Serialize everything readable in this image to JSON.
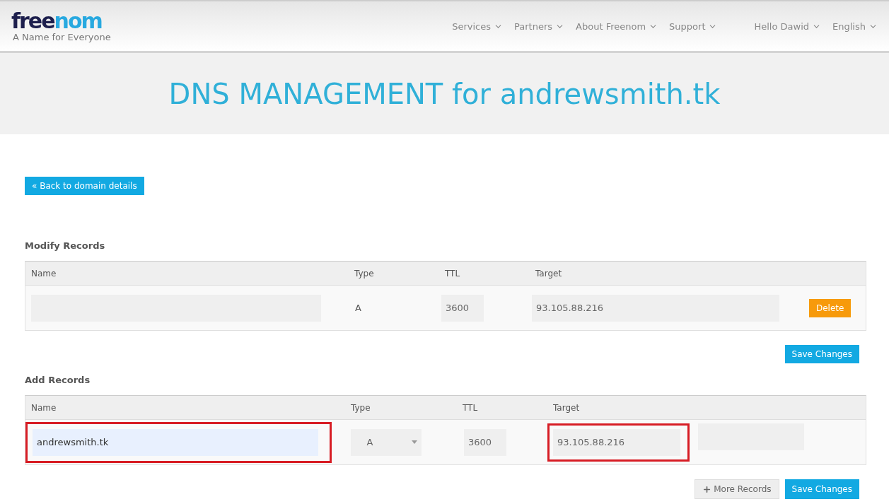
{
  "header": {
    "logo": {
      "dark_part": "free",
      "light_part": "nom"
    },
    "tagline": "A Name for Everyone",
    "nav": [
      {
        "label": "Services"
      },
      {
        "label": "Partners"
      },
      {
        "label": "About Freenom"
      },
      {
        "label": "Support"
      }
    ],
    "user_nav": [
      {
        "label": "Hello Dawid"
      },
      {
        "label": "English"
      }
    ]
  },
  "title": "DNS MANAGEMENT for andrewsmith.tk",
  "back_button": "« Back to domain details",
  "modify_records": {
    "heading": "Modify Records",
    "columns": [
      "Name",
      "Type",
      "TTL",
      "Target"
    ],
    "rows": [
      {
        "name": "",
        "type": "A",
        "ttl": "3600",
        "target": "93.105.88.216",
        "delete": "Delete"
      }
    ],
    "save": "Save Changes"
  },
  "add_records": {
    "heading": "Add Records",
    "columns": [
      "Name",
      "Type",
      "TTL",
      "Target"
    ],
    "rows": [
      {
        "name": "andrewsmith.tk",
        "name_highlighted": true,
        "type": "A",
        "ttl": "3600",
        "target": "93.105.88.216",
        "target_highlighted": true
      }
    ],
    "more": "More Records",
    "save": "Save Changes"
  }
}
